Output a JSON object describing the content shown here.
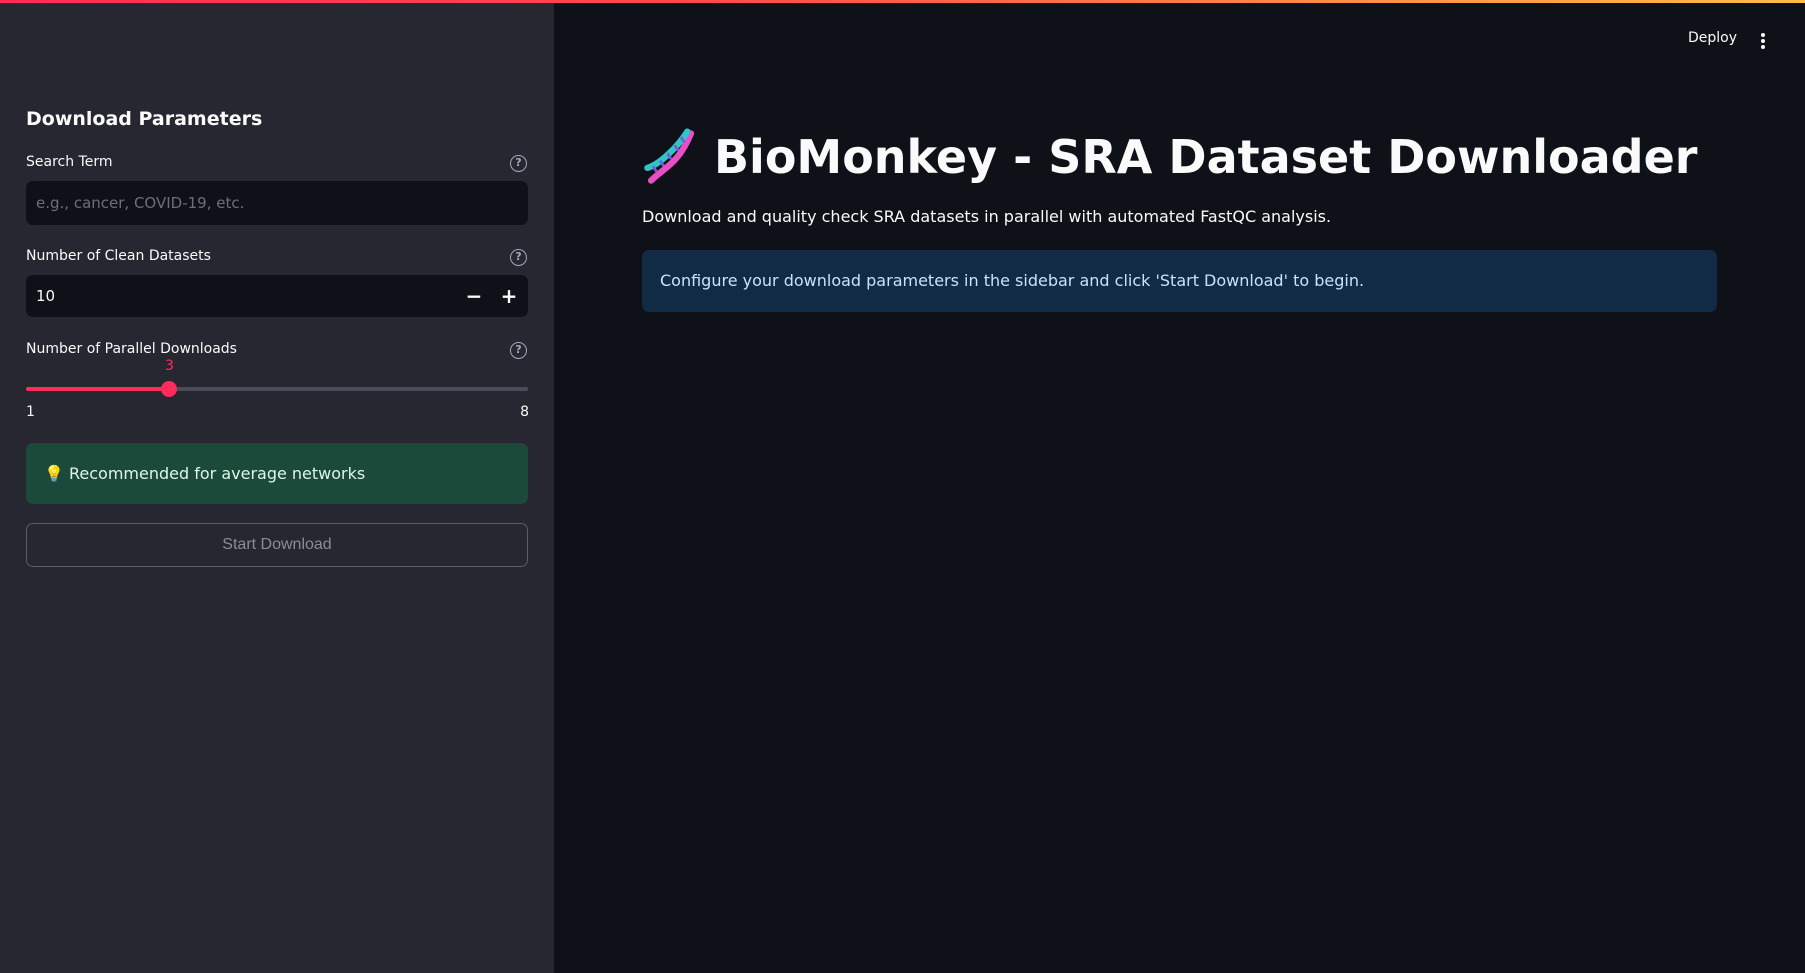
{
  "header": {
    "deploy_label": "Deploy",
    "menu_icon": "vertical-ellipsis-icon"
  },
  "sidebar": {
    "title": "Download Parameters",
    "search": {
      "label": "Search Term",
      "placeholder": "e.g., cancer, COVID-19, etc.",
      "value": ""
    },
    "datasets": {
      "label": "Number of Clean Datasets",
      "value": "10",
      "decrement_label": "−",
      "increment_label": "+"
    },
    "parallel": {
      "label": "Number of Parallel Downloads",
      "value": "3",
      "min": "1",
      "max": "8"
    },
    "recommendation": "💡 Recommended for average networks",
    "start_button": "Start Download",
    "help_glyph": "?"
  },
  "main": {
    "title": "BioMonkey - SRA Dataset Downloader",
    "title_icon": "dna-icon",
    "subtitle": "Download and quality check SRA datasets in parallel with automated FastQC analysis.",
    "info": "Configure your download parameters in the sidebar and click 'Start Download' to begin."
  },
  "colors": {
    "accent": "#ff2b5a",
    "sidebar_bg": "#262730",
    "main_bg": "#0e1117",
    "success_bg": "#1c4a3a",
    "info_bg": "#112a45"
  }
}
